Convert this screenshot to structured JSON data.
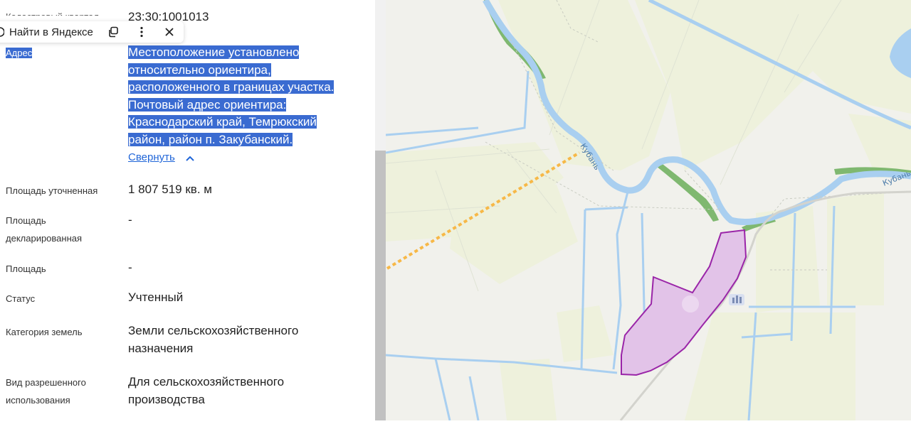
{
  "panel": {
    "cadastral": {
      "label": "Кадастровый квартал",
      "value": "23:30:1001013"
    },
    "popup": {
      "find_label": "Найти в Яндексе",
      "icons": [
        "yandex-search-icon",
        "copy-icon",
        "more-vert-icon",
        "close-icon"
      ]
    },
    "address": {
      "label": "Адрес",
      "lines": [
        "Местоположение установлено",
        "относительно ориентира,",
        "расположенного в границах участка.",
        "Почтовый адрес ориентира:",
        "Краснодарский край, Темрюкский",
        "район, район п. Закубанский."
      ],
      "collapse": "Свернуть"
    },
    "fields": [
      {
        "label": [
          "Площадь уточненная"
        ],
        "value": [
          "1 807 519 кв. м"
        ]
      },
      {
        "label": [
          "Площадь",
          "декларированная"
        ],
        "value": [
          "-"
        ]
      },
      {
        "label": [
          "Площадь"
        ],
        "value": [
          "-"
        ]
      },
      {
        "label": [
          "Статус"
        ],
        "value": [
          "Учтенный"
        ]
      },
      {
        "label": [
          "Категория земель"
        ],
        "value": [
          "Земли сельскохозяйственного",
          "назначения"
        ]
      },
      {
        "label": [
          "Вид разрешенного",
          "использования"
        ],
        "value": [
          "Для сельскохозяйственного",
          "производства"
        ]
      }
    ]
  },
  "map": {
    "river_labels": [
      "Кубань",
      "Кубань"
    ],
    "colors": {
      "water": "#a9cff0",
      "fields": "#eef1dc",
      "parcel_fill": "#e2c3e8",
      "parcel_stroke": "#9a25a8",
      "power_line": "#f7b847",
      "vegetation": "#7fb870"
    }
  }
}
